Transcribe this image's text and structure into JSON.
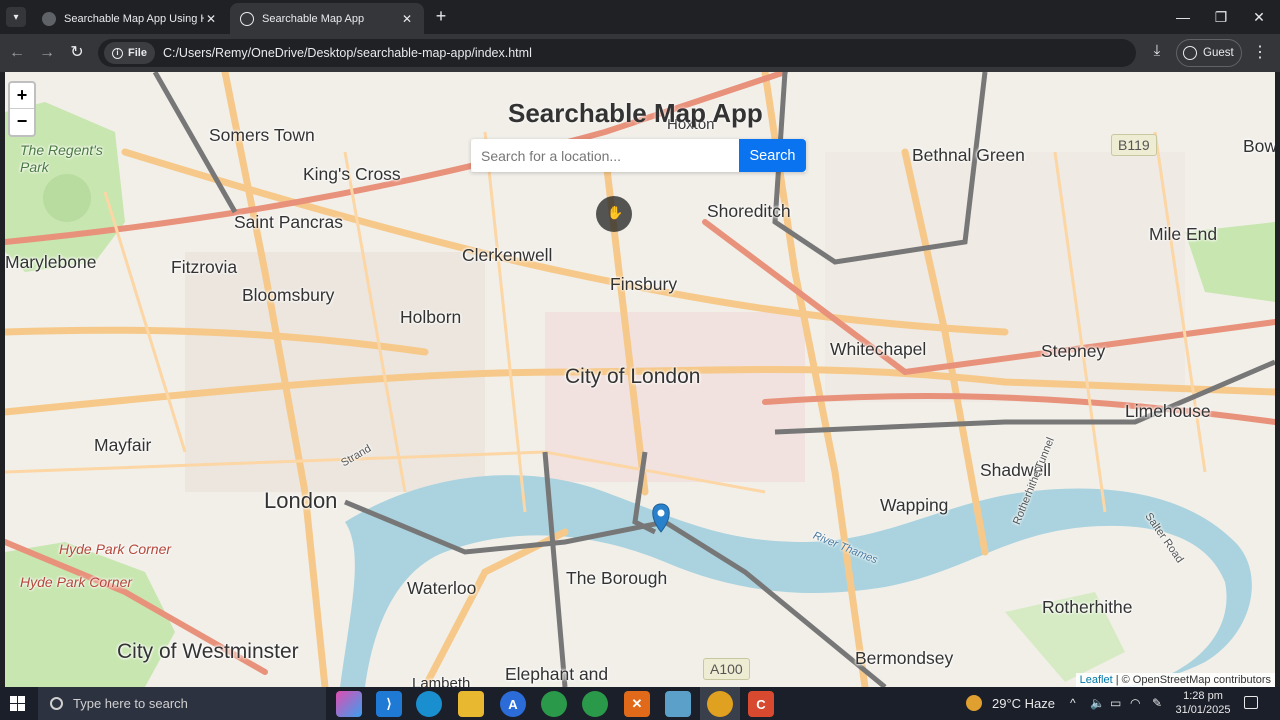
{
  "browser": {
    "tabs": [
      {
        "title": "Searchable Map App Using HTML",
        "active": false
      },
      {
        "title": "Searchable Map App",
        "active": true
      }
    ],
    "new_tab_icon": "+",
    "url_chip": "File",
    "url": "C:/Users/Remy/OneDrive/Desktop/searchable-map-app/index.html",
    "profile_label": "Guest"
  },
  "app": {
    "title": "Searchable Map App",
    "search_placeholder": "Search for a location...",
    "search_value": "",
    "search_button": "Search",
    "zoom_in": "+",
    "zoom_out": "−",
    "attribution_leaflet": "Leaflet",
    "attribution_osm": "| © OpenStreetMap contributors"
  },
  "map": {
    "places": {
      "somers_town": "Somers Town",
      "kings_cross": "King's Cross",
      "saint_pancras": "Saint Pancras",
      "marylebone": "Marylebone",
      "fitzrovia": "Fitzrovia",
      "bloomsbury": "Bloomsbury",
      "holborn": "Holborn",
      "clerkenwell": "Clerkenwell",
      "finsbury": "Finsbury",
      "shoreditch": "Shoreditch",
      "hoxton": "Hoxton",
      "bethnal_green": "Bethnal Green",
      "bow": "Bow",
      "mile_end": "Mile End",
      "whitechapel": "Whitechapel",
      "stepney": "Stepney",
      "city_of_london": "City of London",
      "limehouse": "Limehouse",
      "mayfair": "Mayfair",
      "london": "London",
      "shadwell": "Shadwell",
      "wapping": "Wapping",
      "waterloo": "Waterloo",
      "the_borough": "The Borough",
      "rotherhithe": "Rotherhithe",
      "city_of_westminster": "City of Westminster",
      "bermondsey": "Bermondsey",
      "elephant_and": "Elephant and",
      "lambeth": "Lambeth",
      "regents_park": "The Regent's\nPark",
      "hyde_park_corner_1": "Hyde Park Corner",
      "hyde_park_corner_2": "Hyde Park Corner",
      "strand": "Strand",
      "river_thames": "River Thames",
      "rotherhithe_tunnel": "Rotherhithe Tunnel",
      "salter_road": "Salter Road"
    },
    "shields": {
      "b119": "B119",
      "a100": "A100"
    },
    "river_color": "#aad3df",
    "park_color": "#c8e6b0",
    "road_color": "#f6c98a",
    "marker_color": "#2a81cb"
  },
  "taskbar": {
    "search_placeholder": "Type here to search",
    "weather": "29°C  Haze",
    "time": "1:28 pm",
    "date": "31/01/2025"
  }
}
